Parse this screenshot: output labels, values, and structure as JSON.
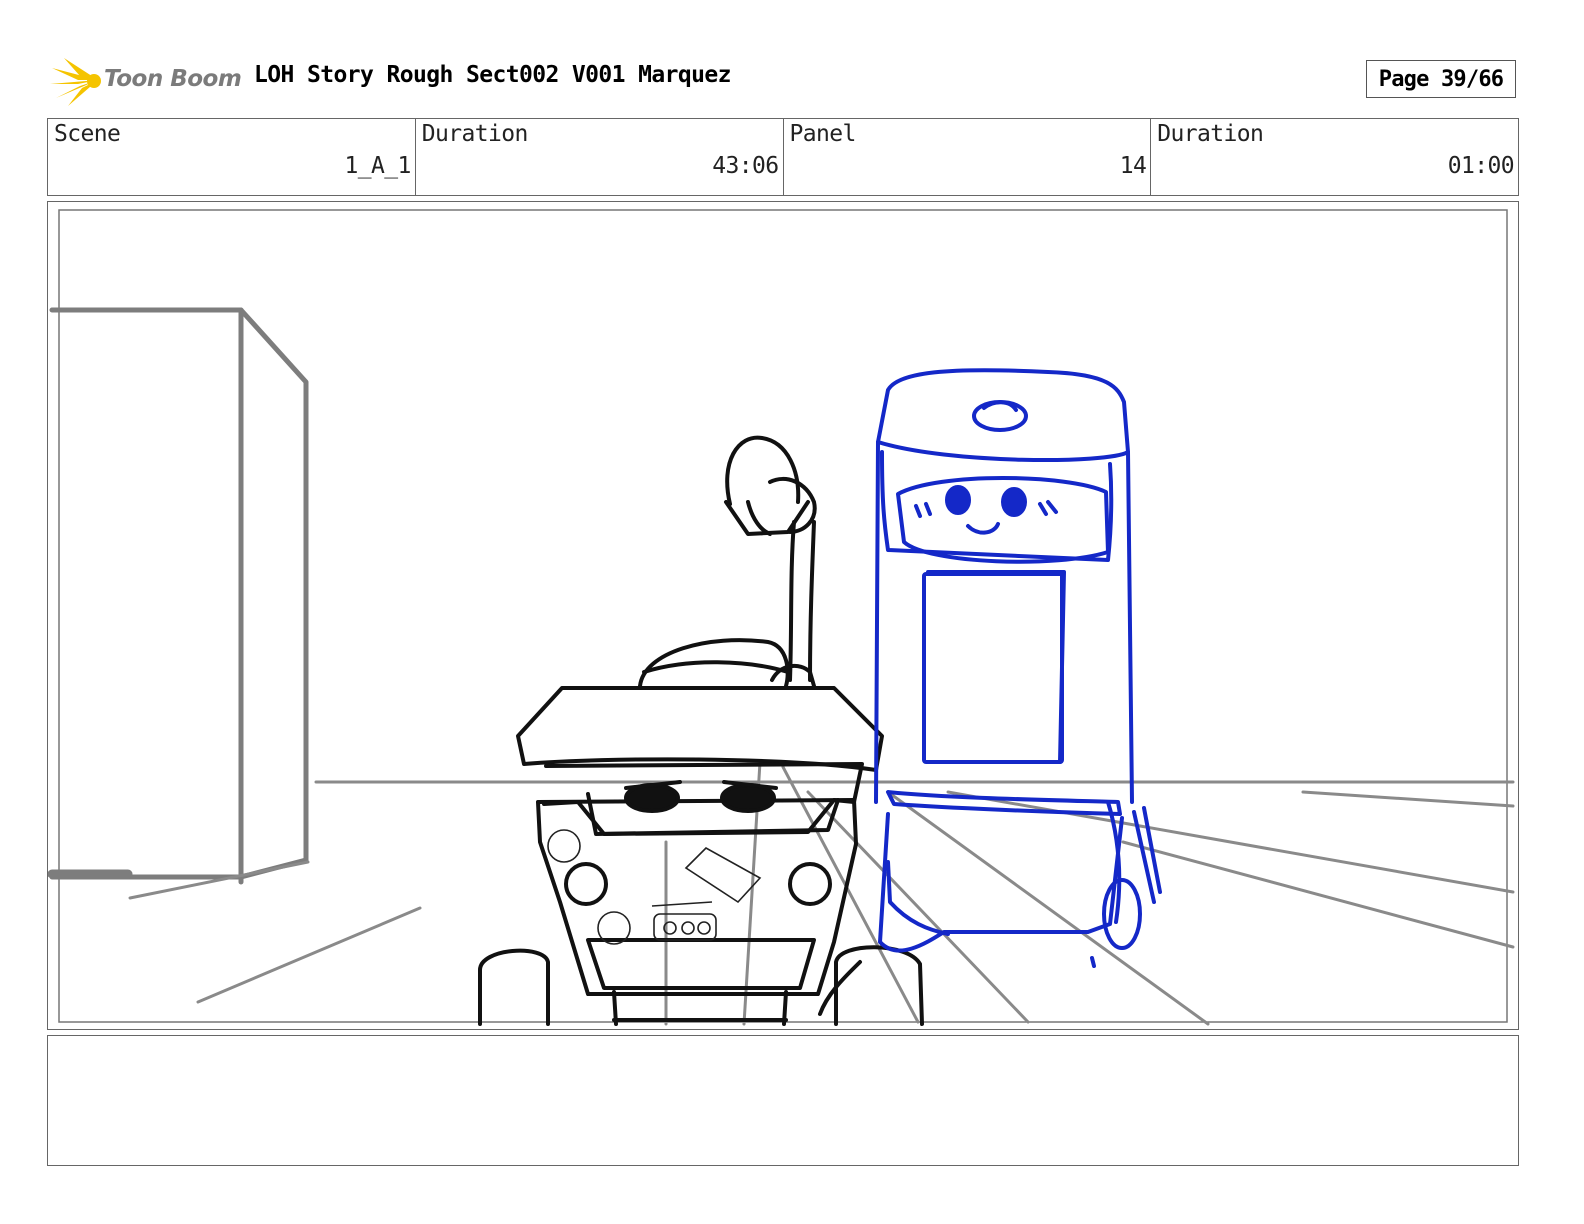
{
  "logo": {
    "text": "Toon Boom",
    "icon": "toon-boom-star-icon",
    "color": "#f5c400"
  },
  "header": {
    "title": "LOH Story Rough Sect002 V001 Marquez",
    "page": "Page 39/66"
  },
  "info": {
    "scene_label": "Scene",
    "scene_value": "1_A_1",
    "scene_duration_label": "Duration",
    "scene_duration_value": "43:06",
    "panel_label": "Panel",
    "panel_value": "14",
    "panel_duration_label": "Duration",
    "panel_duration_value": "01:00"
  },
  "sketch": {
    "stroke_black": "#111111",
    "stroke_grey": "#7d7d7d",
    "stroke_blue": "#1428c8"
  },
  "notes": {
    "text": ""
  }
}
